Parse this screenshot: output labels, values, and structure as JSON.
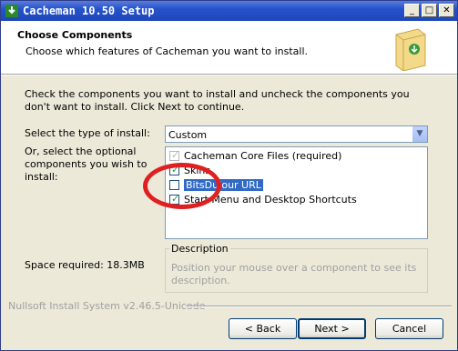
{
  "window": {
    "title": "Cacheman 10.50 Setup"
  },
  "header": {
    "title": "Choose Components",
    "subtitle": "Choose which features of Cacheman you want to install."
  },
  "intro": "Check the components you want to install and uncheck the components you don't want to install. Click Next to continue.",
  "install_type": {
    "label": "Select the type of install:",
    "selected": "Custom"
  },
  "components_label": "Or, select the optional components you wish to install:",
  "components": [
    {
      "label": "Cacheman Core Files (required)",
      "checked": true,
      "disabled": true
    },
    {
      "label": "Skins",
      "checked": true,
      "disabled": false
    },
    {
      "label": "BitsDuJour URL",
      "checked": false,
      "disabled": false
    },
    {
      "label": "Start Menu and Desktop Shortcuts",
      "checked": true,
      "disabled": false
    }
  ],
  "space_required": "Space required: 18.3MB",
  "description": {
    "title": "Description",
    "text": "Position your mouse over a component to see its description."
  },
  "branding": "Nullsoft Install System v2.46.5-Unicode",
  "buttons": {
    "back": "< Back",
    "next": "Next >",
    "cancel": "Cancel"
  },
  "annotation_color": "#e02020"
}
